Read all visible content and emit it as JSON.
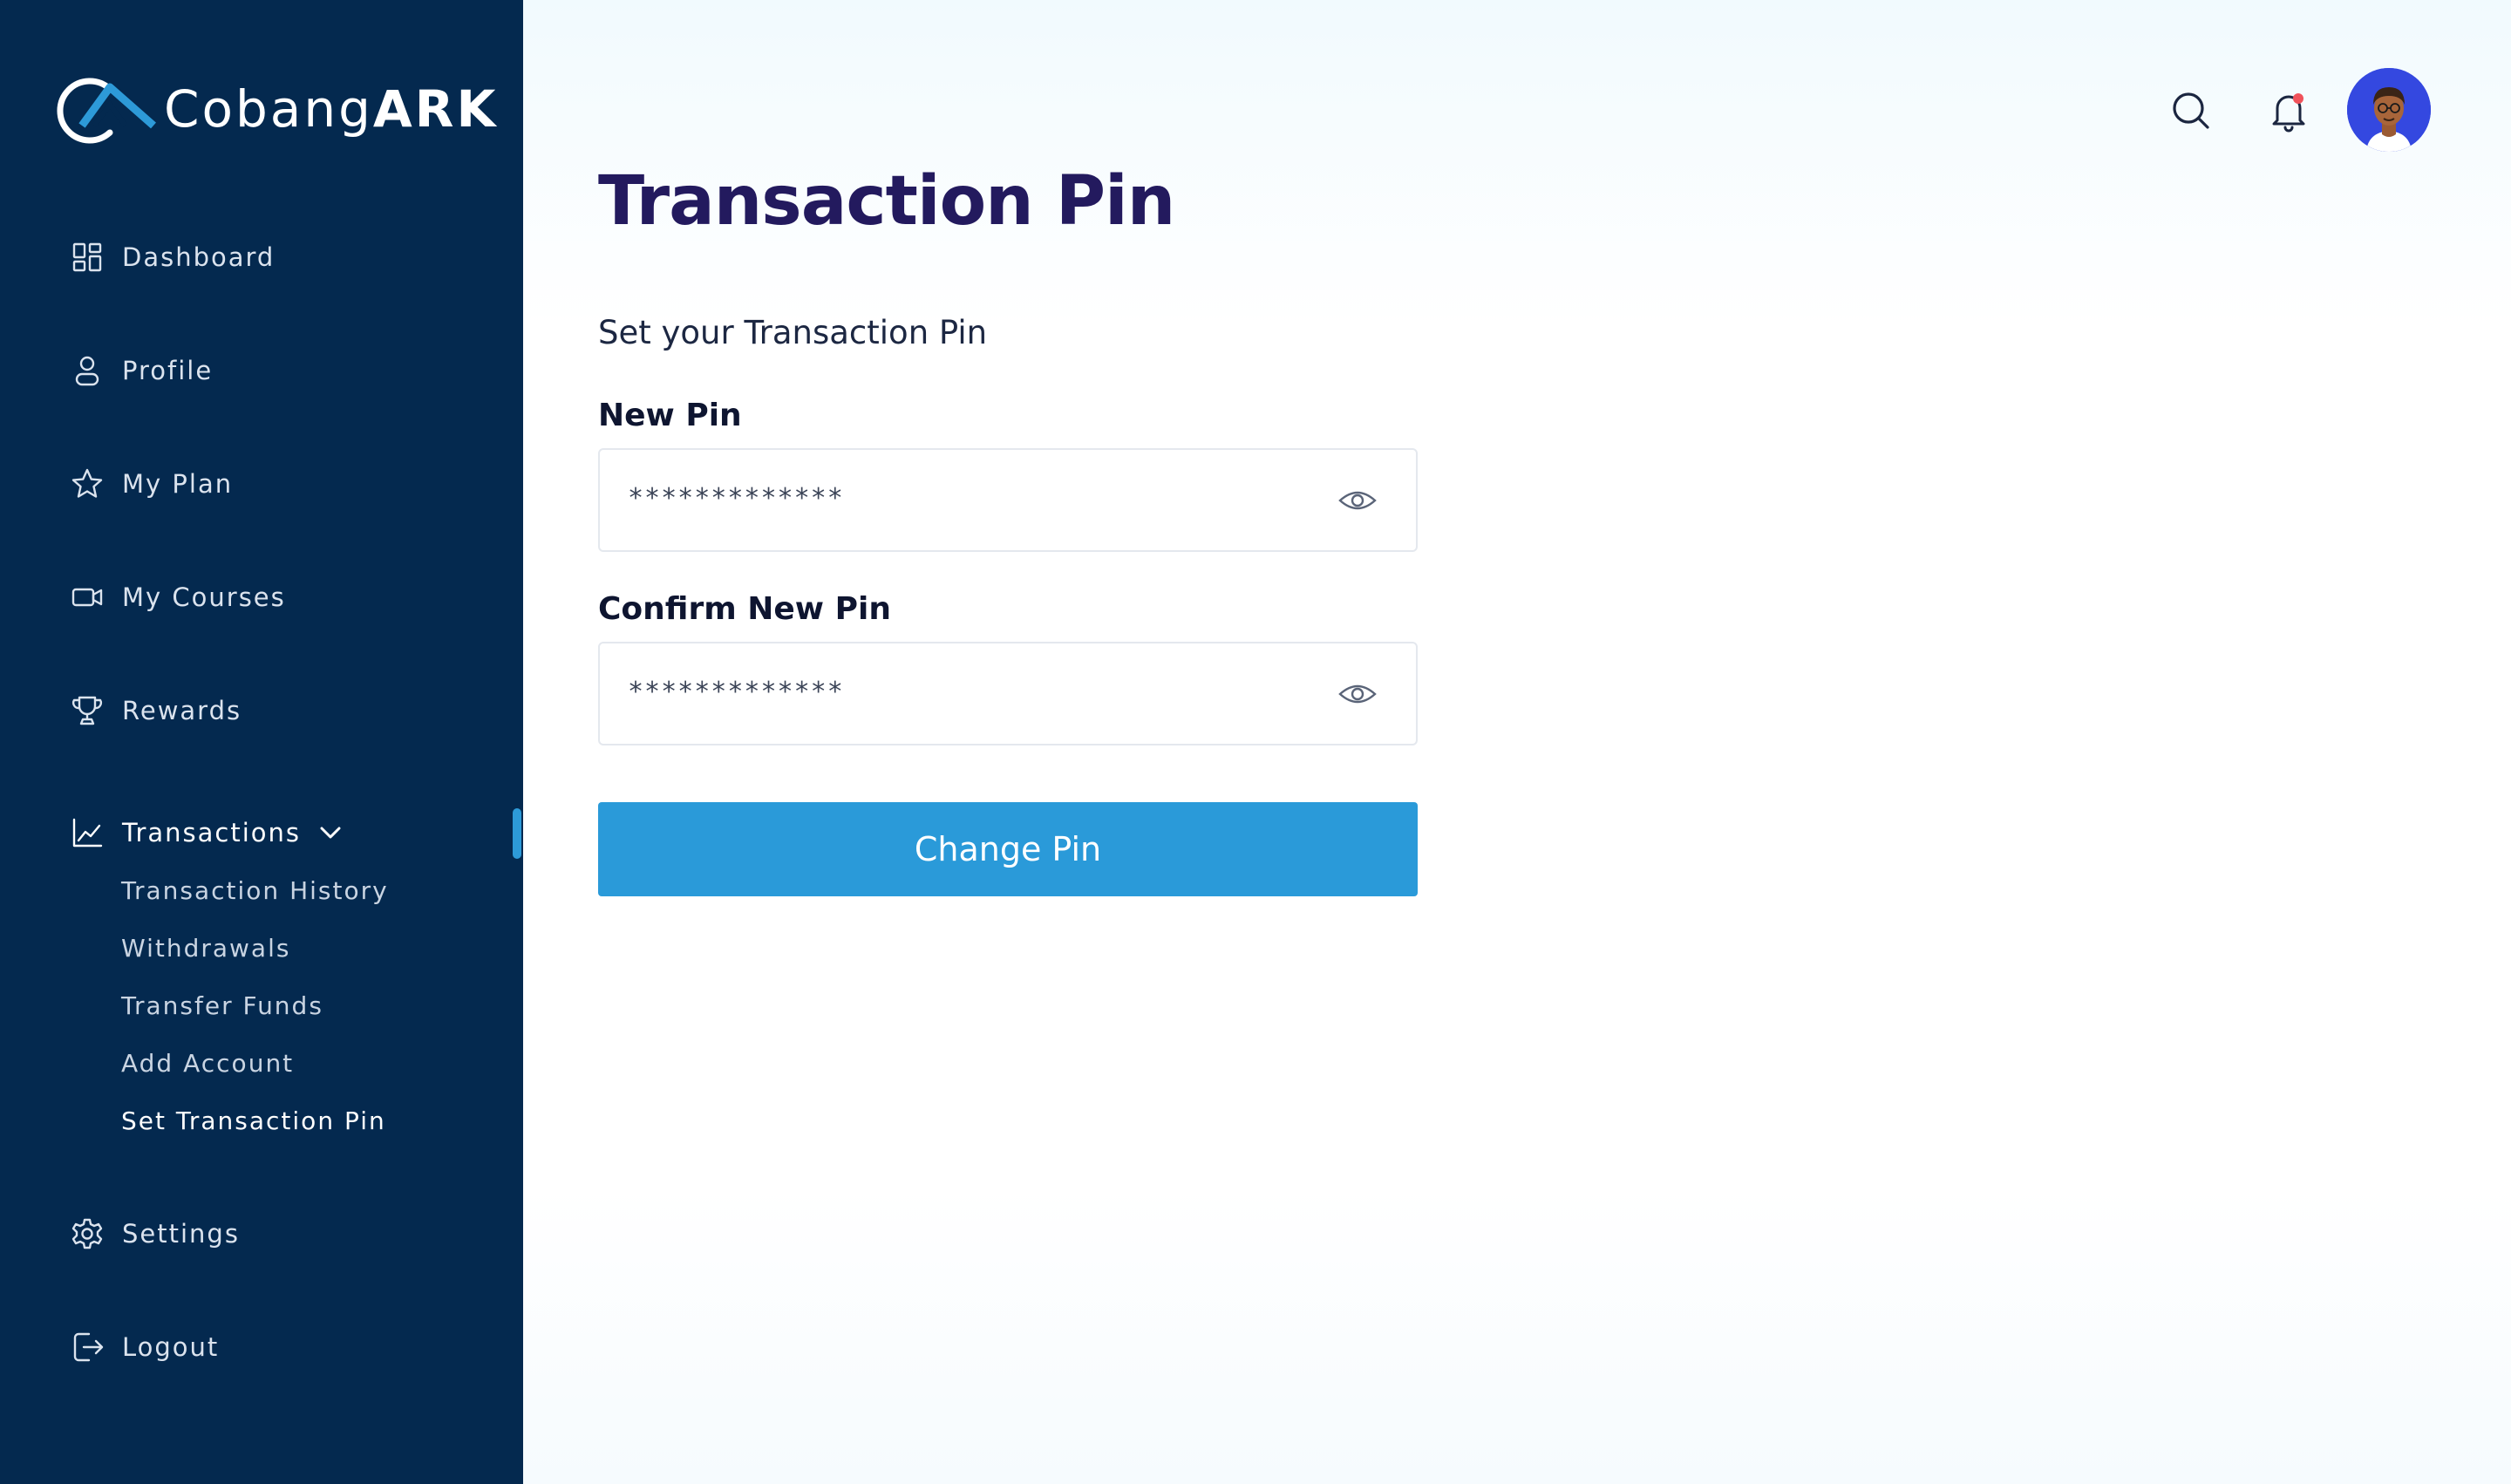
{
  "brand": {
    "name_regular": "Cobang",
    "name_bold": "ARK"
  },
  "sidebar": {
    "items": [
      {
        "label": "Dashboard",
        "icon": "dashboard-grid-icon"
      },
      {
        "label": "Profile",
        "icon": "user-icon"
      },
      {
        "label": "My Plan",
        "icon": "star-icon"
      },
      {
        "label": "My Courses",
        "icon": "video-icon"
      },
      {
        "label": "Rewards",
        "icon": "trophy-icon"
      },
      {
        "label": "Transactions",
        "icon": "chart-line-icon",
        "expanded": true,
        "children": [
          {
            "label": "Transaction History"
          },
          {
            "label": "Withdrawals"
          },
          {
            "label": "Transfer Funds"
          },
          {
            "label": "Add Account"
          },
          {
            "label": "Set Transaction Pin",
            "current": true
          }
        ]
      },
      {
        "label": "Settings",
        "icon": "gear-icon"
      },
      {
        "label": "Logout",
        "icon": "logout-icon"
      }
    ]
  },
  "topbar": {
    "icons": [
      "search-icon",
      "bell-icon",
      "avatar"
    ],
    "notification_dot": true
  },
  "page": {
    "title": "Transaction Pin",
    "subtitle": "Set your Transaction Pin",
    "fields": [
      {
        "label": "New Pin",
        "value": "*************"
      },
      {
        "label": "Confirm New Pin",
        "value": "*************"
      }
    ],
    "submit_label": "Change Pin"
  },
  "colors": {
    "sidebar_bg": "#04294f",
    "accent": "#2a9ad9",
    "title": "#231a5e",
    "notification": "#f0525a"
  }
}
